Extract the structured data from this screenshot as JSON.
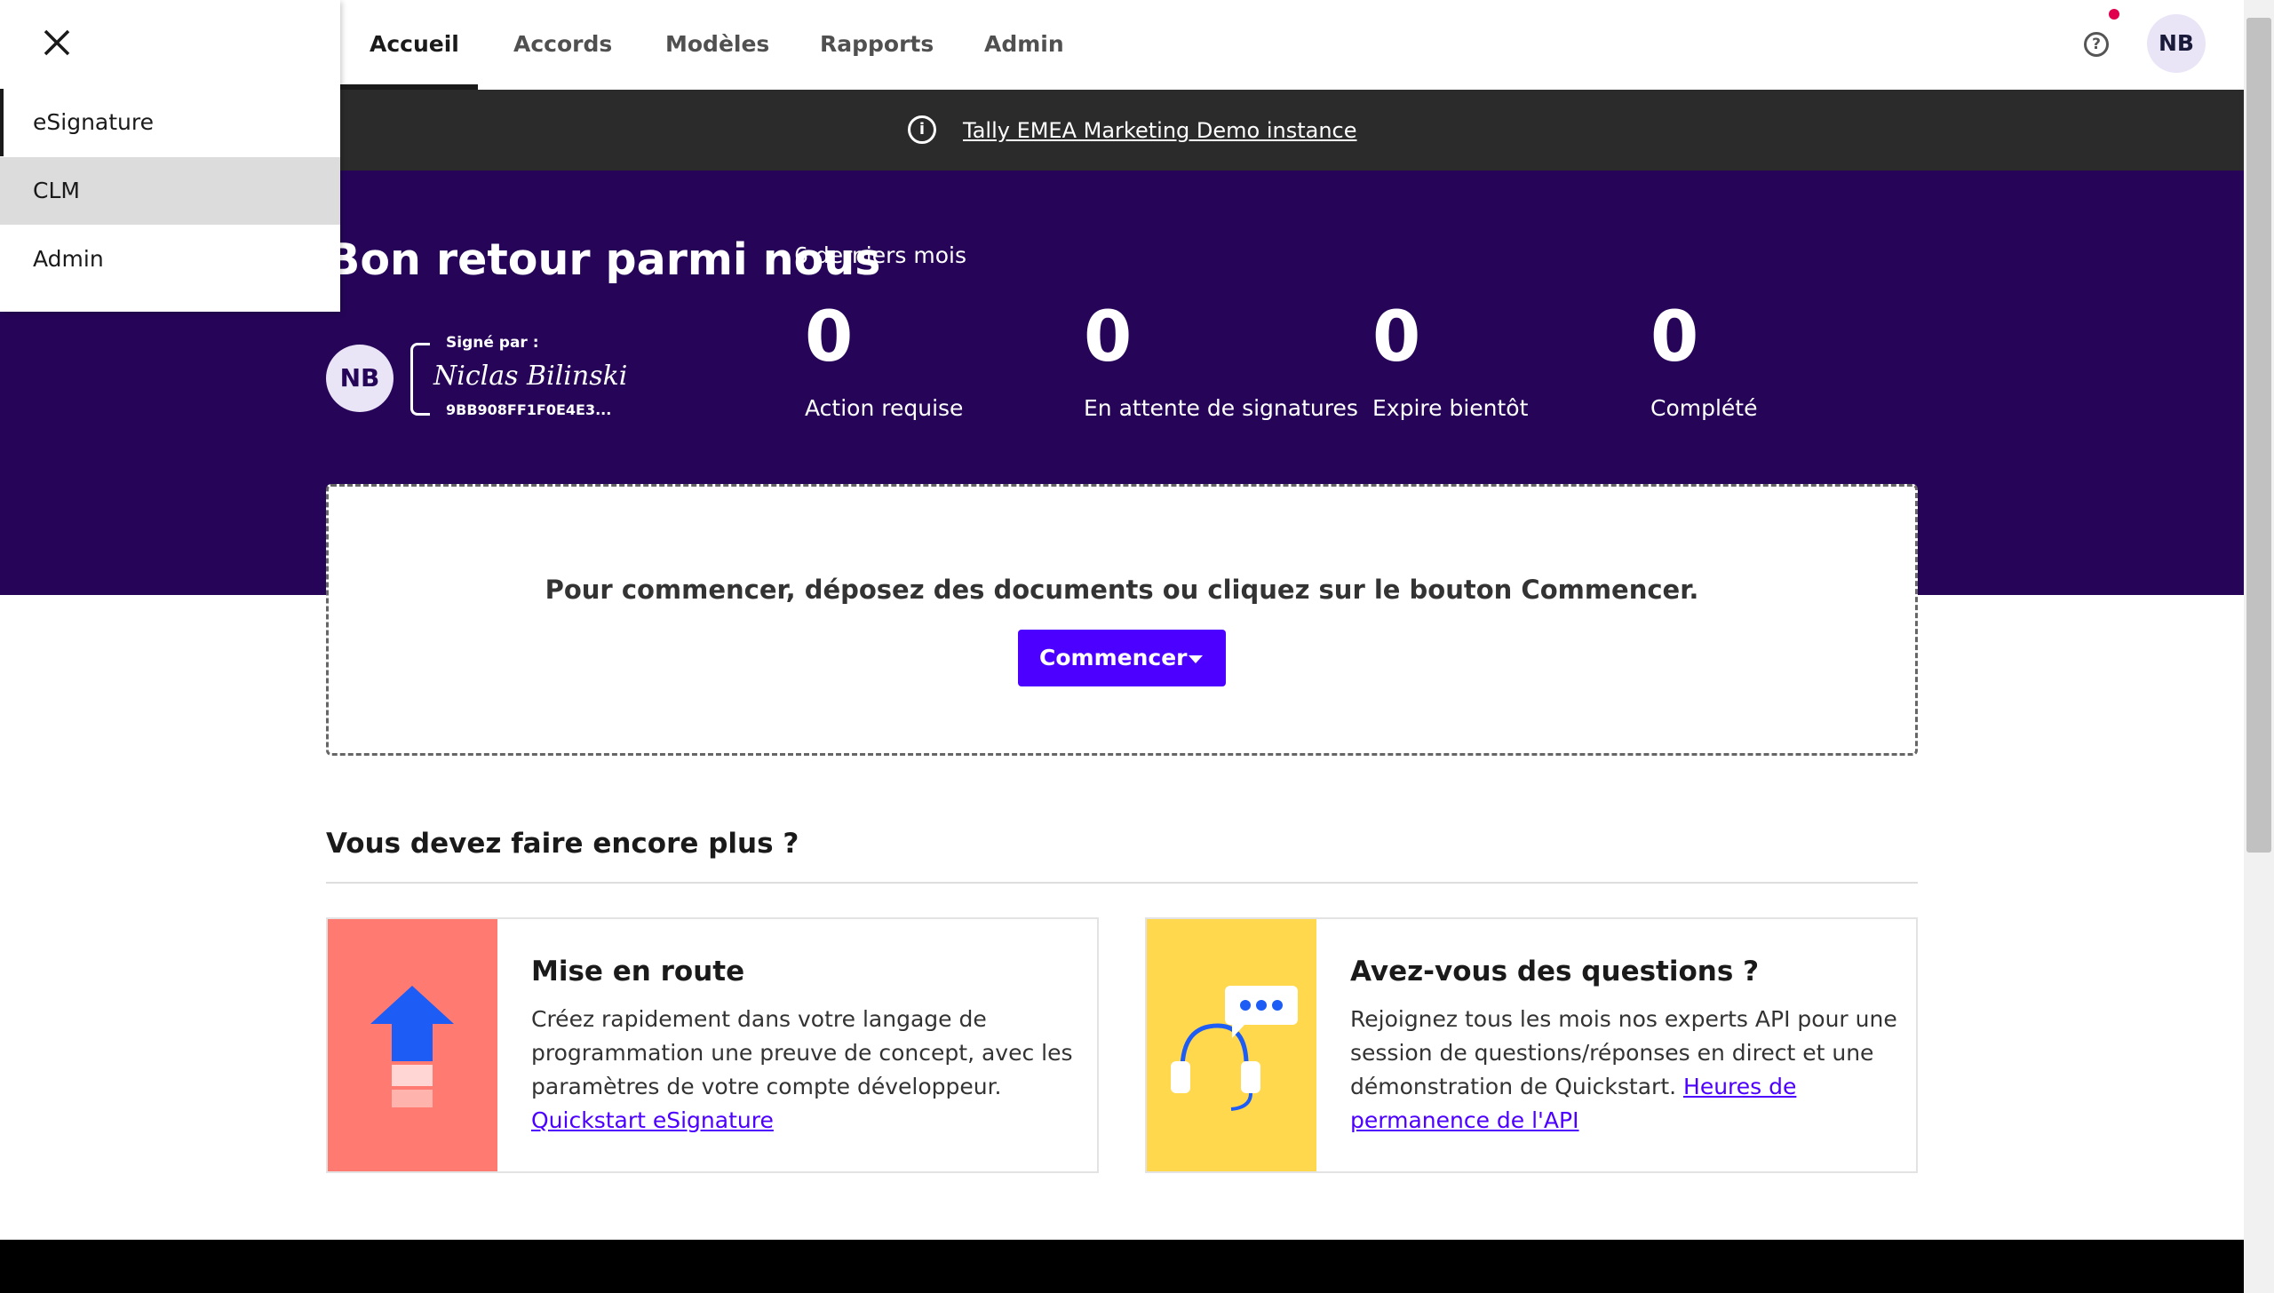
{
  "nav": {
    "tabs": [
      {
        "label": "Accueil",
        "active": true
      },
      {
        "label": "Accords"
      },
      {
        "label": "Modèles"
      },
      {
        "label": "Rapports"
      },
      {
        "label": "Admin"
      }
    ],
    "help_icon": "question-circle-icon",
    "user_initials": "NB"
  },
  "banner": {
    "icon": "info-circle-icon",
    "text": "Tally EMEA Marketing Demo instance"
  },
  "hero": {
    "title": "Bon retour parmi nous",
    "period": "6 derniers mois",
    "avatar_initials": "NB",
    "signature": {
      "label": "Signé par :",
      "name": "Niclas Bilinski",
      "id": "9BB908FF1F0E4E3..."
    },
    "stats": [
      {
        "value": "0",
        "label": "Action requise"
      },
      {
        "value": "0",
        "label": "En attente de signatures"
      },
      {
        "value": "0",
        "label": "Expire bientôt"
      },
      {
        "value": "0",
        "label": "Complété"
      }
    ]
  },
  "dropzone": {
    "text": "Pour commencer, déposez des documents ou cliquez sur le bouton Commencer.",
    "button_label": "Commencer"
  },
  "more": {
    "title": "Vous devez faire encore plus ?",
    "cards": [
      {
        "title": "Mise en route",
        "body": "Créez rapidement dans votre langage de programmation une preuve de concept, avec les paramètres de votre compte développeur. ",
        "link": "Quickstart eSignature",
        "image_icon": "upload-arrow-icon",
        "color": "#ff7a70"
      },
      {
        "title": "Avez-vous des questions ?",
        "body": "Rejoignez tous les mois nos experts API pour une session de questions/réponses en direct et une démonstration de Quickstart. ",
        "link": "Heures de permanence de l'API",
        "image_icon": "headset-chat-icon",
        "color": "#ffd84d"
      }
    ]
  },
  "app_switcher": {
    "close_icon": "close-icon",
    "items": [
      {
        "label": "eSignature",
        "current": true
      },
      {
        "label": "CLM",
        "hovered": true
      },
      {
        "label": "Admin"
      }
    ]
  },
  "colors": {
    "hero_bg": "#260559",
    "primary": "#4c00ff",
    "banner_bg": "#2b2b2b"
  }
}
